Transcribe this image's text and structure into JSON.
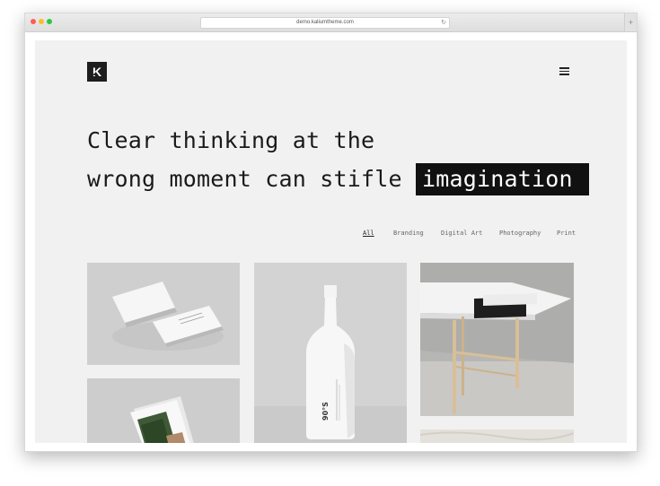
{
  "browser": {
    "url": "demo.kaliumtheme.com",
    "reload_glyph": "↻",
    "newtab_glyph": "+"
  },
  "header": {
    "logo_letter": "K",
    "menu_icon": "hamburger-menu-icon"
  },
  "hero": {
    "line1": "Clear thinking at the",
    "line2_prefix": "wrong moment can stifle",
    "line2_highlight": "imagination"
  },
  "filters": [
    {
      "label": "All",
      "active": true
    },
    {
      "label": "Branding",
      "active": false
    },
    {
      "label": "Digital Art",
      "active": false
    },
    {
      "label": "Photography",
      "active": false
    },
    {
      "label": "Print",
      "active": false
    }
  ],
  "portfolio": {
    "bottle_label": "90°S"
  },
  "colors": {
    "page_bg": "#f1f1f1",
    "ink": "#1a1a1a",
    "highlight_bg": "#111111"
  }
}
